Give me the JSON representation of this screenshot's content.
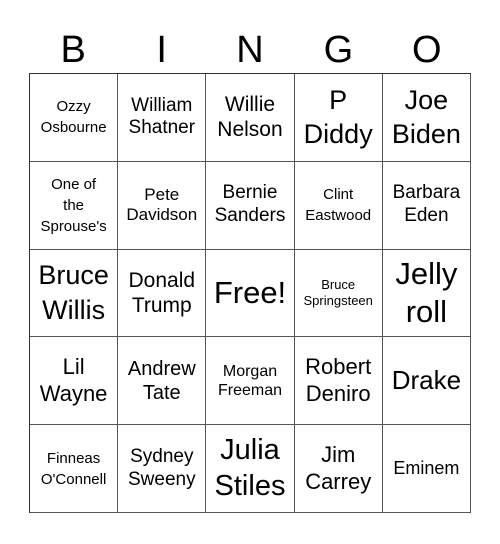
{
  "header": {
    "letters": [
      "B",
      "I",
      "N",
      "G",
      "O"
    ]
  },
  "card": {
    "rows": [
      [
        "Ozzy\nOsbourne",
        "William\nShatner",
        "Willie\nNelson",
        "P\nDiddy",
        "Joe\nBiden"
      ],
      [
        "One of\nthe\nSprouse's",
        "Pete\nDavidson",
        "Bernie\nSanders",
        "Clint\nEastwood",
        "Barbara\nEden"
      ],
      [
        "Bruce\nWillis",
        "Donald\nTrump",
        "Free!",
        "Bruce\nSpringsteen",
        "Jelly\nroll"
      ],
      [
        "Lil\nWayne",
        "Andrew\nTate",
        "Morgan\nFreeman",
        "Robert\nDeniro",
        "Drake"
      ],
      [
        "Finneas\nO'Connell",
        "Sydney\nSweeny",
        "Julia\nStiles",
        "Jim\nCarrey",
        "Eminem"
      ]
    ],
    "free_space": "Free!"
  },
  "colors": {
    "grid_line": "#555555",
    "text": "#000000",
    "background": "#ffffff"
  }
}
